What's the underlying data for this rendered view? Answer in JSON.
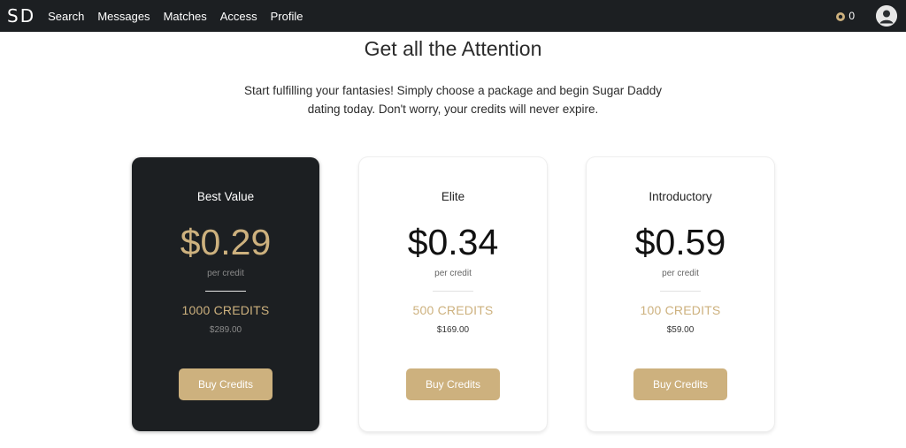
{
  "nav": {
    "logo": "SD",
    "links": [
      "Search",
      "Messages",
      "Matches",
      "Access",
      "Profile"
    ],
    "credits_count": "0"
  },
  "page": {
    "title": "Get all the Attention",
    "subtitle": "Start fulfilling your fantasies! Simply choose a package and begin Sugar Daddy dating today. Don't worry, your credits will never expire."
  },
  "packages": [
    {
      "name": "Best Value",
      "price": "$0.29",
      "per": "per credit",
      "credits": "1000 CREDITS",
      "total": "$289.00",
      "button": "Buy Credits",
      "theme": "dark"
    },
    {
      "name": "Elite",
      "price": "$0.34",
      "per": "per credit",
      "credits": "500 CREDITS",
      "total": "$169.00",
      "button": "Buy Credits",
      "theme": "light"
    },
    {
      "name": "Introductory",
      "price": "$0.59",
      "per": "per credit",
      "credits": "100 CREDITS",
      "total": "$59.00",
      "button": "Buy Credits",
      "theme": "light"
    }
  ],
  "icons": {
    "coin": "coin-icon",
    "avatar": "user-avatar-icon"
  },
  "colors": {
    "navbar": "#1c1f22",
    "accent_gold": "#cdb17e",
    "dark_card": "#1c1f22"
  }
}
